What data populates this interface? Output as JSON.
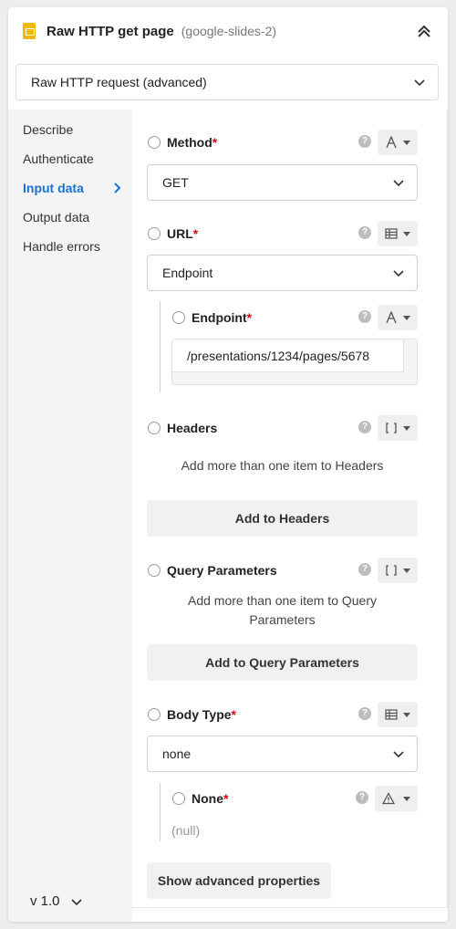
{
  "header": {
    "title": "Raw HTTP get page",
    "subtitle": "(google-slides-2)"
  },
  "action_select": {
    "value": "Raw HTTP request (advanced)"
  },
  "sidebar": {
    "items": [
      {
        "label": "Describe"
      },
      {
        "label": "Authenticate"
      },
      {
        "label": "Input data"
      },
      {
        "label": "Output data"
      },
      {
        "label": "Handle errors"
      }
    ],
    "active": "Input data",
    "version": "v 1.0"
  },
  "fields": {
    "method": {
      "label": "Method",
      "required": "*",
      "value": "GET",
      "type_icon": "text-type-icon"
    },
    "url": {
      "label": "URL",
      "required": "*",
      "value": "Endpoint",
      "type_icon": "table-type-icon"
    },
    "endpoint": {
      "label": "Endpoint",
      "required": "*",
      "value": "/presentations/1234/pages/5678",
      "type_icon": "text-type-icon"
    },
    "headers": {
      "label": "Headers",
      "hint": "Add more than one item to Headers",
      "add_label": "Add to Headers",
      "type_icon": "list-type-icon"
    },
    "query": {
      "label": "Query Parameters",
      "hint": "Add more than one item to Query Parameters",
      "add_label": "Add to Query Parameters",
      "type_icon": "list-type-icon"
    },
    "body_type": {
      "label": "Body Type",
      "required": "*",
      "value": "none",
      "type_icon": "table-type-icon"
    },
    "none": {
      "label": "None",
      "required": "*",
      "value": "(null)",
      "type_icon": "warning-icon"
    }
  },
  "help_glyph": "?",
  "advanced_label": "Show advanced properties",
  "colors": {
    "accent": "#1a6fd6",
    "required": "#d0021b",
    "app_icon": "#f5b800"
  }
}
